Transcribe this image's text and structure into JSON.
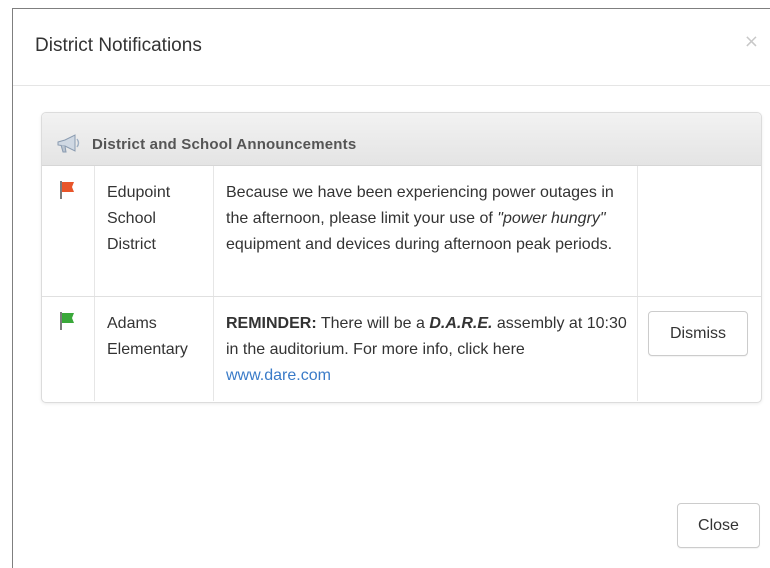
{
  "modal": {
    "title": "District Notifications",
    "close_x": "×",
    "close_button_label": "Close"
  },
  "panel": {
    "title": "District and School Announcements",
    "icon": "megaphone-icon"
  },
  "announcements": [
    {
      "flag_icon": "flag-icon",
      "flag_color": "#e8552a",
      "source": "Edupoint School District",
      "message": {
        "part1": "Because we have been experiencing power outages in the afternoon, please limit your use of ",
        "emphasis": "\"power hungry\"",
        "part2": " equipment and devices during afternoon peak periods."
      },
      "action": ""
    },
    {
      "flag_icon": "flag-icon",
      "flag_color": "#3aa83a",
      "source": "Adams Elementary",
      "message": {
        "label": "REMINDER:",
        "part1": " There will be a ",
        "emphasis": "D.A.R.E.",
        "part2": " assembly at 10:30 in the auditorium. For more info, click here ",
        "link": "www.dare.com"
      },
      "action": "Dismiss"
    }
  ]
}
